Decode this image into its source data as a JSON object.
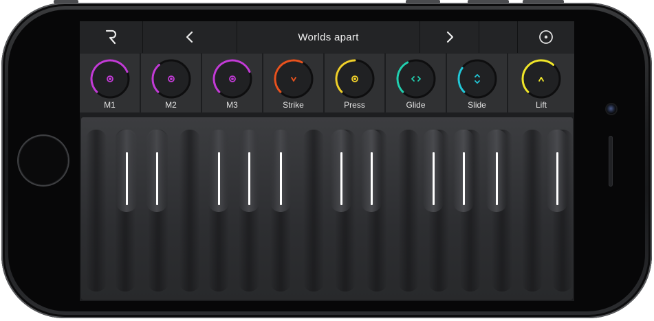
{
  "header": {
    "logo": "R",
    "prev_icon": "chevron-left-icon",
    "preset_name": "Worlds apart",
    "next_icon": "chevron-right-icon",
    "settings_icon": "circle-dot-icon"
  },
  "dials": [
    {
      "label": "M1",
      "color": "#c23bd6",
      "level": 0.75,
      "glyph": "dot"
    },
    {
      "label": "M2",
      "color": "#c23bd6",
      "level": 0.35,
      "glyph": "dot"
    },
    {
      "label": "M3",
      "color": "#c23bd6",
      "level": 0.75,
      "glyph": "dot"
    },
    {
      "label": "Strike",
      "color": "#e8521e",
      "level": 0.6,
      "glyph": "v"
    },
    {
      "label": "Press",
      "color": "#f0d02a",
      "level": 0.5,
      "glyph": "dot"
    },
    {
      "label": "Glide",
      "color": "#22d0b0",
      "level": 0.4,
      "glyph": "lr"
    },
    {
      "label": "Slide",
      "color": "#22c8d8",
      "level": 0.3,
      "glyph": "ud"
    },
    {
      "label": "Lift",
      "color": "#f0e62a",
      "level": 0.65,
      "glyph": "up"
    }
  ]
}
